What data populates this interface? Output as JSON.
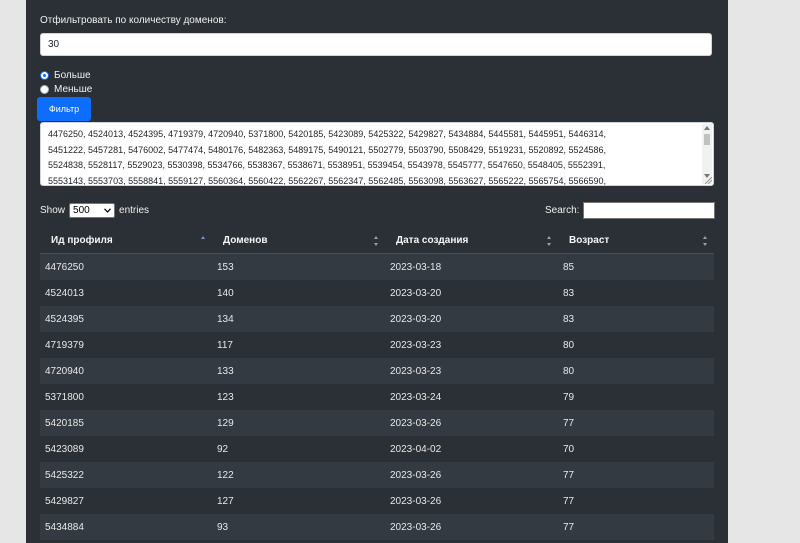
{
  "filter": {
    "label": "Отфильтровать по количеству доменов:",
    "count_value": "30",
    "radio_more": "Больше",
    "radio_less": "Меньше",
    "button": "Фильтр"
  },
  "ids_text": [
    "4476250, 4524013, 4524395, 4719379, 4720940, 5371800, 5420185, 5423089, 5425322, 5429827, 5434884, 5445581, 5445951, 5446314,",
    "5451222, 5457281, 5476002, 5477474, 5480176, 5482363, 5489175, 5490121, 5502779, 5503790, 5508429, 5519231, 5520892, 5524586,",
    "5524838, 5528117, 5529023, 5530398, 5534766, 5538367, 5538671, 5538951, 5539454, 5543978, 5545777, 5547650, 5548405, 5552391,",
    "5553143, 5553703, 5558841, 5559127, 5560364, 5560422, 5562267, 5562347, 5562485, 5563098, 5563627, 5565222, 5565754, 5566590,"
  ],
  "table_controls": {
    "show": "Show",
    "entries_value": "500",
    "entries": "entries",
    "search": "Search:"
  },
  "table": {
    "headers": [
      "Ид профиля",
      "Доменов",
      "Дата создания",
      "Возраст"
    ],
    "rows": [
      [
        "4476250",
        "153",
        "2023-03-18",
        "85"
      ],
      [
        "4524013",
        "140",
        "2023-03-20",
        "83"
      ],
      [
        "4524395",
        "134",
        "2023-03-20",
        "83"
      ],
      [
        "4719379",
        "117",
        "2023-03-23",
        "80"
      ],
      [
        "4720940",
        "133",
        "2023-03-23",
        "80"
      ],
      [
        "5371800",
        "123",
        "2023-03-24",
        "79"
      ],
      [
        "5420185",
        "129",
        "2023-03-26",
        "77"
      ],
      [
        "5423089",
        "92",
        "2023-04-02",
        "70"
      ],
      [
        "5425322",
        "122",
        "2023-03-26",
        "77"
      ],
      [
        "5429827",
        "127",
        "2023-03-26",
        "77"
      ],
      [
        "5434884",
        "93",
        "2023-03-26",
        "77"
      ]
    ]
  },
  "colors": {
    "panel": "#2b3036",
    "accent": "#0d6efd",
    "row_odd": "#343a41"
  }
}
